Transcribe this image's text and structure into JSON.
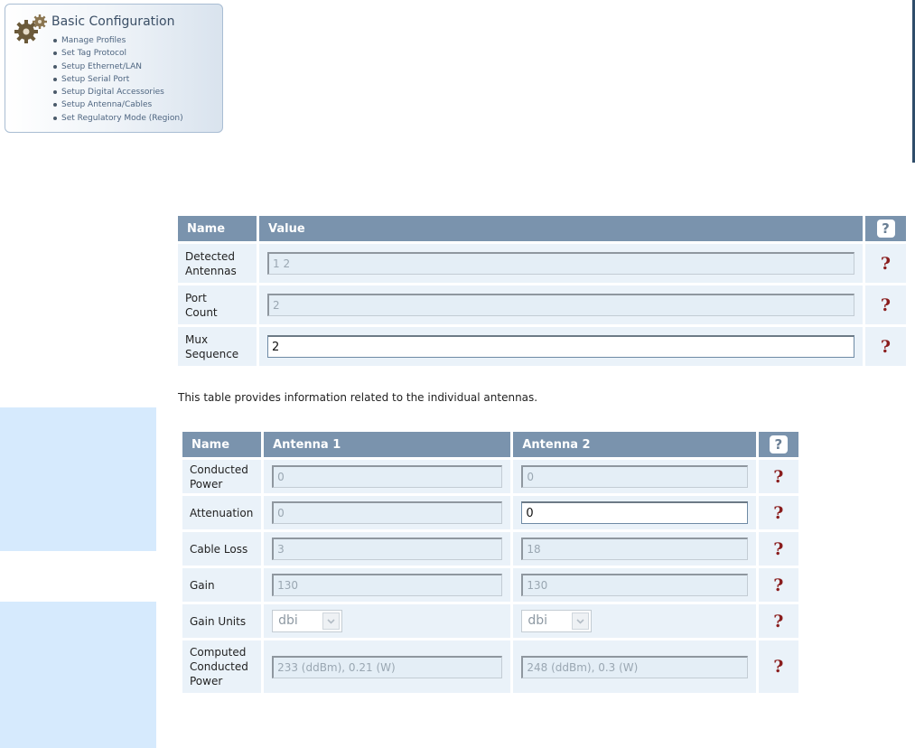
{
  "config": {
    "title": "Basic Configuration",
    "items": [
      "Manage Profiles",
      "Set Tag Protocol",
      "Setup Ethernet/LAN",
      "Setup Serial Port",
      "Setup Digital Accessories",
      "Setup Antenna/Cables",
      "Set Regulatory Mode (Region)"
    ]
  },
  "ports_table": {
    "headers": {
      "name": "Name",
      "value": "Value",
      "help": "?"
    },
    "rows": [
      {
        "label_line1": "Detected",
        "label_line2": "Antennas",
        "value": "1 2",
        "editable": false
      },
      {
        "label_line1": "Port",
        "label_line2": "Count",
        "value": "2",
        "editable": false
      },
      {
        "label_line1": "Mux",
        "label_line2": "Sequence",
        "value": "2",
        "editable": true
      }
    ],
    "help_symbol": "?"
  },
  "description": "This table provides information related to the individual antennas.",
  "antenna_table": {
    "headers": {
      "name": "Name",
      "antenna1": "Antenna 1",
      "antenna2": "Antenna 2",
      "help": "?"
    },
    "rows": {
      "conducted_power": {
        "label_line1": "Conducted",
        "label_line2": "Power",
        "a1": "0",
        "a2": "0"
      },
      "attenuation": {
        "label": "Attenuation",
        "a1": "0",
        "a2": "0"
      },
      "cable_loss": {
        "label": "Cable Loss",
        "a1": "3",
        "a2": "18"
      },
      "gain": {
        "label": "Gain",
        "a1": "130",
        "a2": "130"
      },
      "gain_units": {
        "label": "Gain Units",
        "a1": "dbi",
        "a2": "dbi"
      },
      "computed_power": {
        "label_line1": "Computed",
        "label_line2": "Conducted",
        "label_line3": "Power",
        "a1": "233 (ddBm), 0.21 (W)",
        "a2": "248 (ddBm), 0.3 (W)"
      }
    },
    "help_symbol": "?"
  },
  "colors": {
    "header_bg": "#7a93ad",
    "cell_bg": "#eaf2f9",
    "help_mark": "#8a1d1d",
    "side_panel": "#d6eafd"
  }
}
